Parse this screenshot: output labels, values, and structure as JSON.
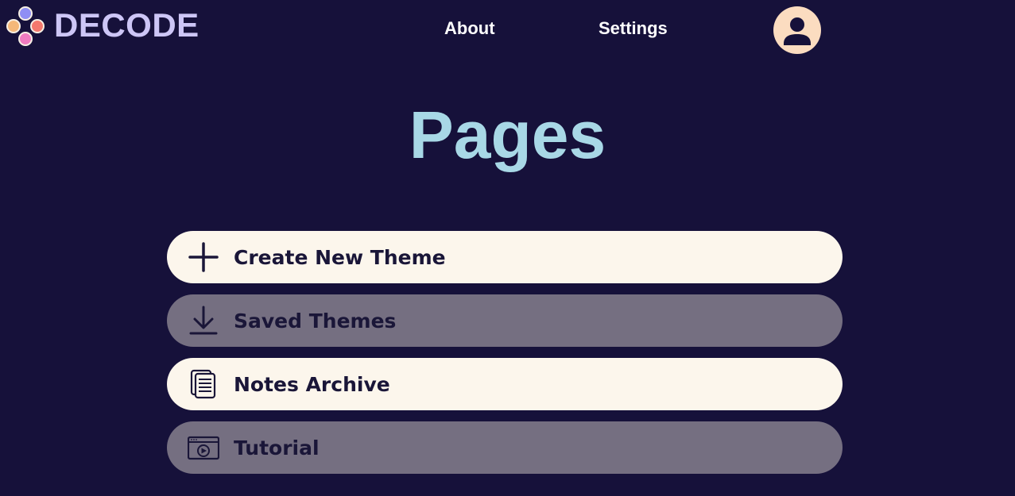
{
  "brand": {
    "name": "DECODE",
    "dot_colors": [
      "#8f8ef4",
      "#f5b879",
      "#f4786d",
      "#f07bc0"
    ]
  },
  "nav": {
    "about": "About",
    "settings": "Settings"
  },
  "page": {
    "title": "Pages",
    "title_color": "#a8d8e6"
  },
  "menu": {
    "items": [
      {
        "label": "Create New Theme",
        "icon": "plus-icon",
        "state": "active"
      },
      {
        "label": "Saved Themes",
        "icon": "download-icon",
        "state": "dim"
      },
      {
        "label": "Notes Archive",
        "icon": "documents-icon",
        "state": "active"
      },
      {
        "label": "Tutorial",
        "icon": "video-player-icon",
        "state": "dim"
      }
    ]
  },
  "colors": {
    "background": "#16113a",
    "item_active_bg": "#fcf6ec",
    "item_dim_bg": "#756f81",
    "item_text": "#1a1638",
    "avatar_bg": "#fbdcc0"
  }
}
